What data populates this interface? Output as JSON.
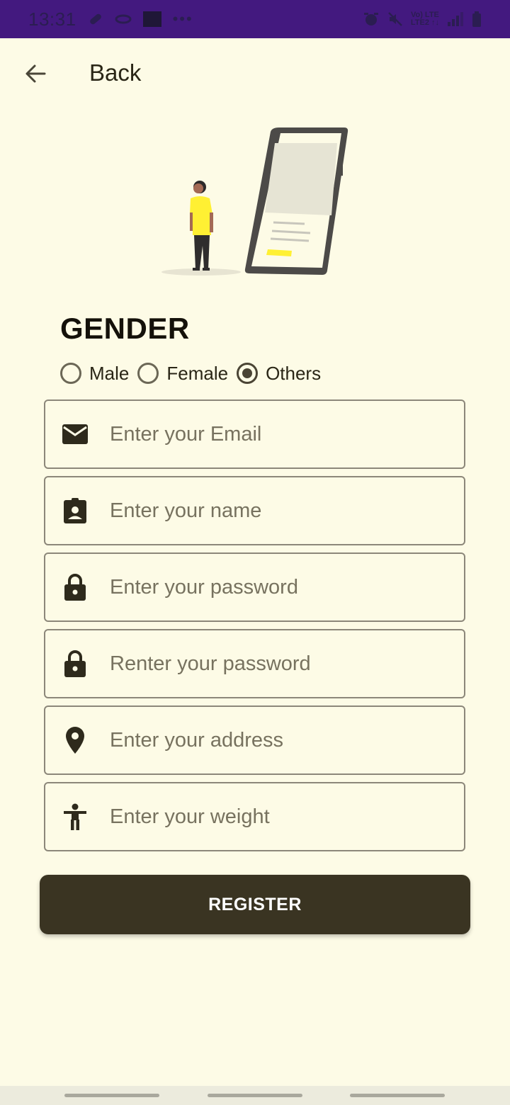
{
  "status_bar": {
    "time": "13:31",
    "net_top": "Vo) LTE",
    "net_bottom": "LTE2 ↑↓"
  },
  "app_bar": {
    "back_icon": "arrow-back-icon",
    "title": "Back"
  },
  "gender": {
    "title": "GENDER",
    "options": [
      {
        "label": "Male",
        "checked": false
      },
      {
        "label": "Female",
        "checked": false
      },
      {
        "label": "Others",
        "checked": true
      }
    ]
  },
  "form": {
    "fields": [
      {
        "icon": "email-icon",
        "placeholder": "Enter your Email"
      },
      {
        "icon": "badge-icon",
        "placeholder": "Enter your name"
      },
      {
        "icon": "lock-icon",
        "placeholder": "Enter your password"
      },
      {
        "icon": "lock-icon",
        "placeholder": "Renter your password"
      },
      {
        "icon": "location-pin-icon",
        "placeholder": "Enter your address"
      },
      {
        "icon": "accessibility-icon",
        "placeholder": "Enter your weight"
      }
    ],
    "submit_label": "REGISTER"
  },
  "colors": {
    "status_bar": "#43197f",
    "background": "#fdfbe6",
    "button": "#3a3422",
    "accent_yellow": "#fff033"
  }
}
